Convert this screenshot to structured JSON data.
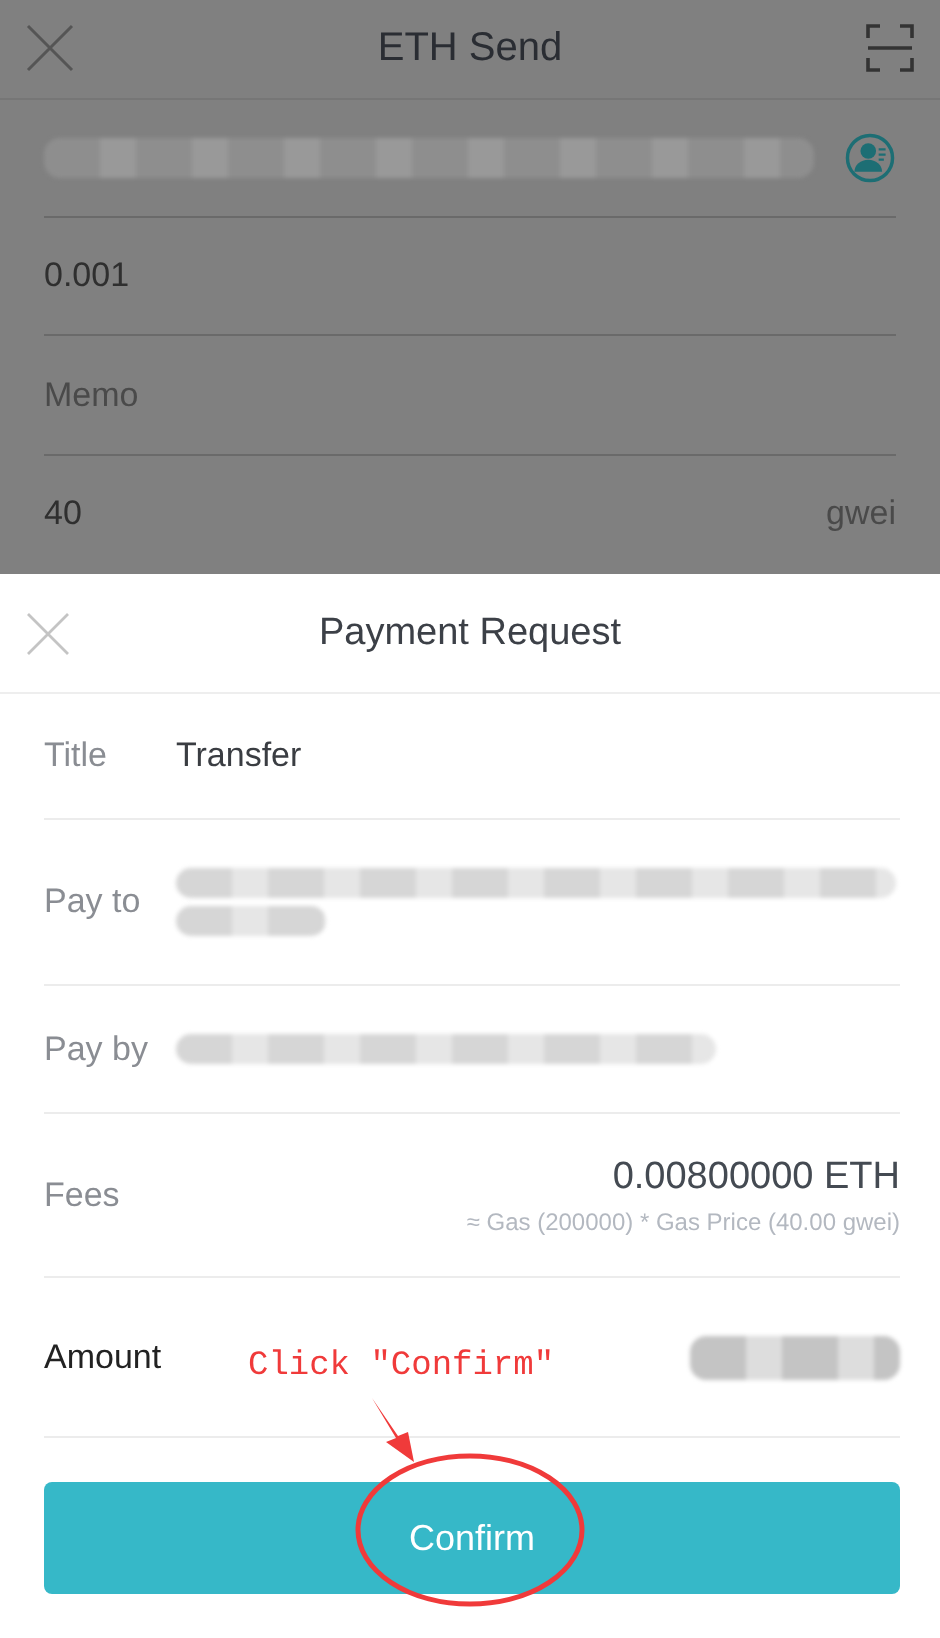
{
  "screen": {
    "title": "ETH Send"
  },
  "form": {
    "address_redacted": true,
    "amount": "0.001",
    "memo_placeholder": "Memo",
    "gas_price": "40",
    "gas_unit": "gwei"
  },
  "sheet": {
    "title": "Payment Request",
    "rows": [
      {
        "kind": "text",
        "label": "Title",
        "value": "Transfer"
      },
      {
        "kind": "redacted",
        "label": "Pay to",
        "wrapped": true
      },
      {
        "kind": "redacted",
        "label": "Pay by",
        "wrapped": false
      },
      {
        "kind": "fee",
        "label": "Fees",
        "value": "0.00800000 ETH",
        "detail": "≈ Gas (200000) * Gas Price (40.00 gwei)"
      },
      {
        "kind": "amount",
        "label": "Amount"
      }
    ],
    "button": "Confirm"
  },
  "annotation": {
    "text": "Click ″Confirm″"
  }
}
